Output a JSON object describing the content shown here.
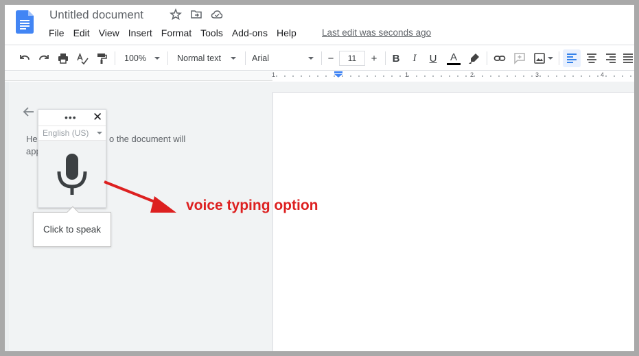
{
  "app": {
    "doc_title": "Untitled document",
    "last_edit": "Last edit was seconds ago"
  },
  "menu": {
    "items": [
      "File",
      "Edit",
      "View",
      "Insert",
      "Format",
      "Tools",
      "Add-ons",
      "Help"
    ]
  },
  "toolbar": {
    "zoom": "100%",
    "style": "Normal text",
    "font": "Arial",
    "font_size": "11",
    "decrease": "−",
    "increase": "+",
    "bold": "B",
    "italic": "I",
    "underline": "U",
    "text_color": "A"
  },
  "ruler": {
    "numbers": [
      "1",
      "1",
      "2",
      "3",
      "4"
    ]
  },
  "voice_panel": {
    "hint_text": "He           o the document will app",
    "hint_line1_a": "He",
    "hint_line1_b": "o the document will",
    "hint_line2": "app",
    "more": "•••",
    "close": "✕",
    "language": "English (US)",
    "tooltip": "Click to speak"
  },
  "annotation": {
    "label": "voice typing option",
    "color": "#dd2020"
  },
  "colors": {
    "accent_blue": "#4285f4",
    "annotation_red": "#dd2020"
  }
}
